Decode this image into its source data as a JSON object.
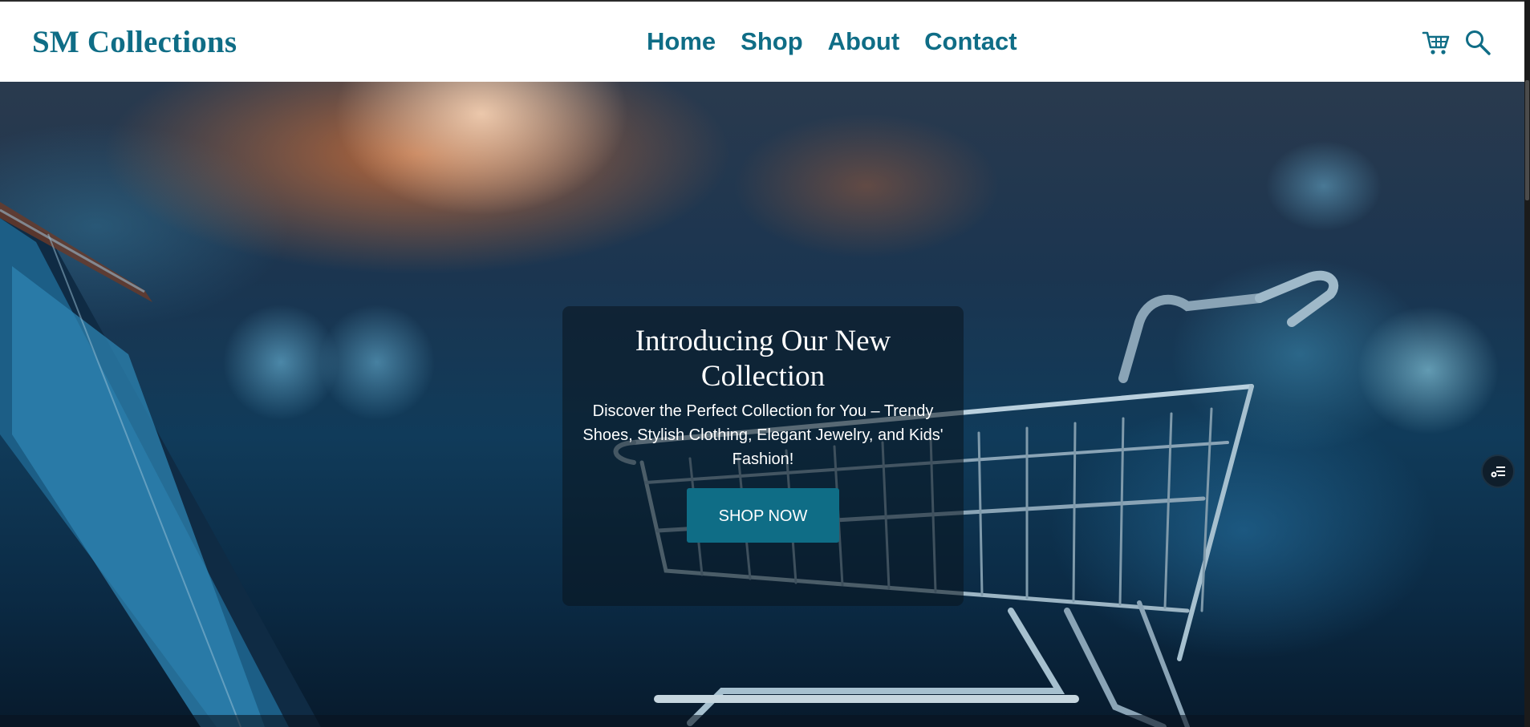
{
  "header": {
    "brand": "SM Collections",
    "nav": [
      {
        "label": "Home"
      },
      {
        "label": "Shop"
      },
      {
        "label": "About"
      },
      {
        "label": "Contact"
      }
    ],
    "icons": [
      "cart-icon",
      "search-icon"
    ]
  },
  "hero": {
    "title": "Introducing Our New Collection",
    "subtitle": "Discover the Perfect Collection for You – Trendy Shoes, Stylish Clothing, Elegant Jewelry, and Kids' Fashion!",
    "button_label": "SHOP NOW",
    "background_image": "blurred shopping cart beside a laptop"
  },
  "floating_widget": {
    "icon": "toggle-list-icon"
  },
  "colors": {
    "brand": "#0f6d86",
    "header_bg": "#ffffff",
    "card_bg": "rgba(10,20,30,0.55)",
    "button_bg": "#0f6d86",
    "text_light": "#ffffff"
  }
}
